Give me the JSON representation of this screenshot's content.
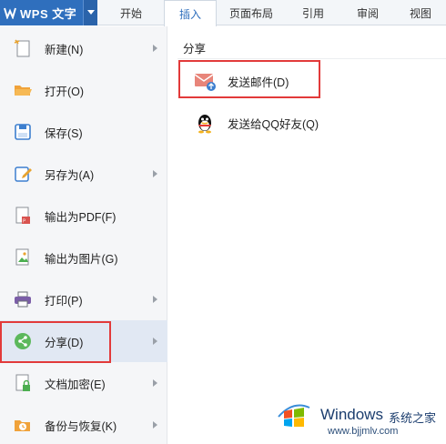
{
  "app": {
    "title": "WPS 文字",
    "logo_icon": "wps-w-logo-icon",
    "accent": "#2f6fbd"
  },
  "tabs": [
    {
      "label": "开始"
    },
    {
      "label": "插入"
    },
    {
      "label": "页面布局"
    },
    {
      "label": "引用"
    },
    {
      "label": "审阅"
    },
    {
      "label": "视图"
    }
  ],
  "active_tab": "插入",
  "menu": {
    "items": [
      {
        "label": "新建(N)",
        "icon": "new-document-icon",
        "submenu": true
      },
      {
        "label": "打开(O)",
        "icon": "open-folder-icon",
        "submenu": false
      },
      {
        "label": "保存(S)",
        "icon": "save-icon",
        "submenu": false
      },
      {
        "label": "另存为(A)",
        "icon": "save-as-icon",
        "submenu": true
      },
      {
        "label": "输出为PDF(F)",
        "icon": "export-pdf-icon",
        "submenu": false
      },
      {
        "label": "输出为图片(G)",
        "icon": "export-image-icon",
        "submenu": false
      },
      {
        "label": "打印(P)",
        "icon": "print-icon",
        "submenu": true
      },
      {
        "label": "分享(D)",
        "icon": "share-icon",
        "submenu": true,
        "selected": true
      },
      {
        "label": "文档加密(E)",
        "icon": "encrypt-document-icon",
        "submenu": true
      },
      {
        "label": "备份与恢复(K)",
        "icon": "backup-restore-icon",
        "submenu": true
      }
    ]
  },
  "share_pane": {
    "title": "分享",
    "items": [
      {
        "label": "发送邮件(D)",
        "icon": "email-send-icon"
      },
      {
        "label": "发送给QQ好友(Q)",
        "icon": "qq-penguin-icon"
      }
    ]
  },
  "watermark": {
    "title": "Windows",
    "subtitle": "系统之家",
    "url": "www.bjjmlv.com",
    "icon": "windows-logo-icon"
  },
  "colors": {
    "highlight": "#e23a3a",
    "selected_bg": "#e1e8f3"
  }
}
